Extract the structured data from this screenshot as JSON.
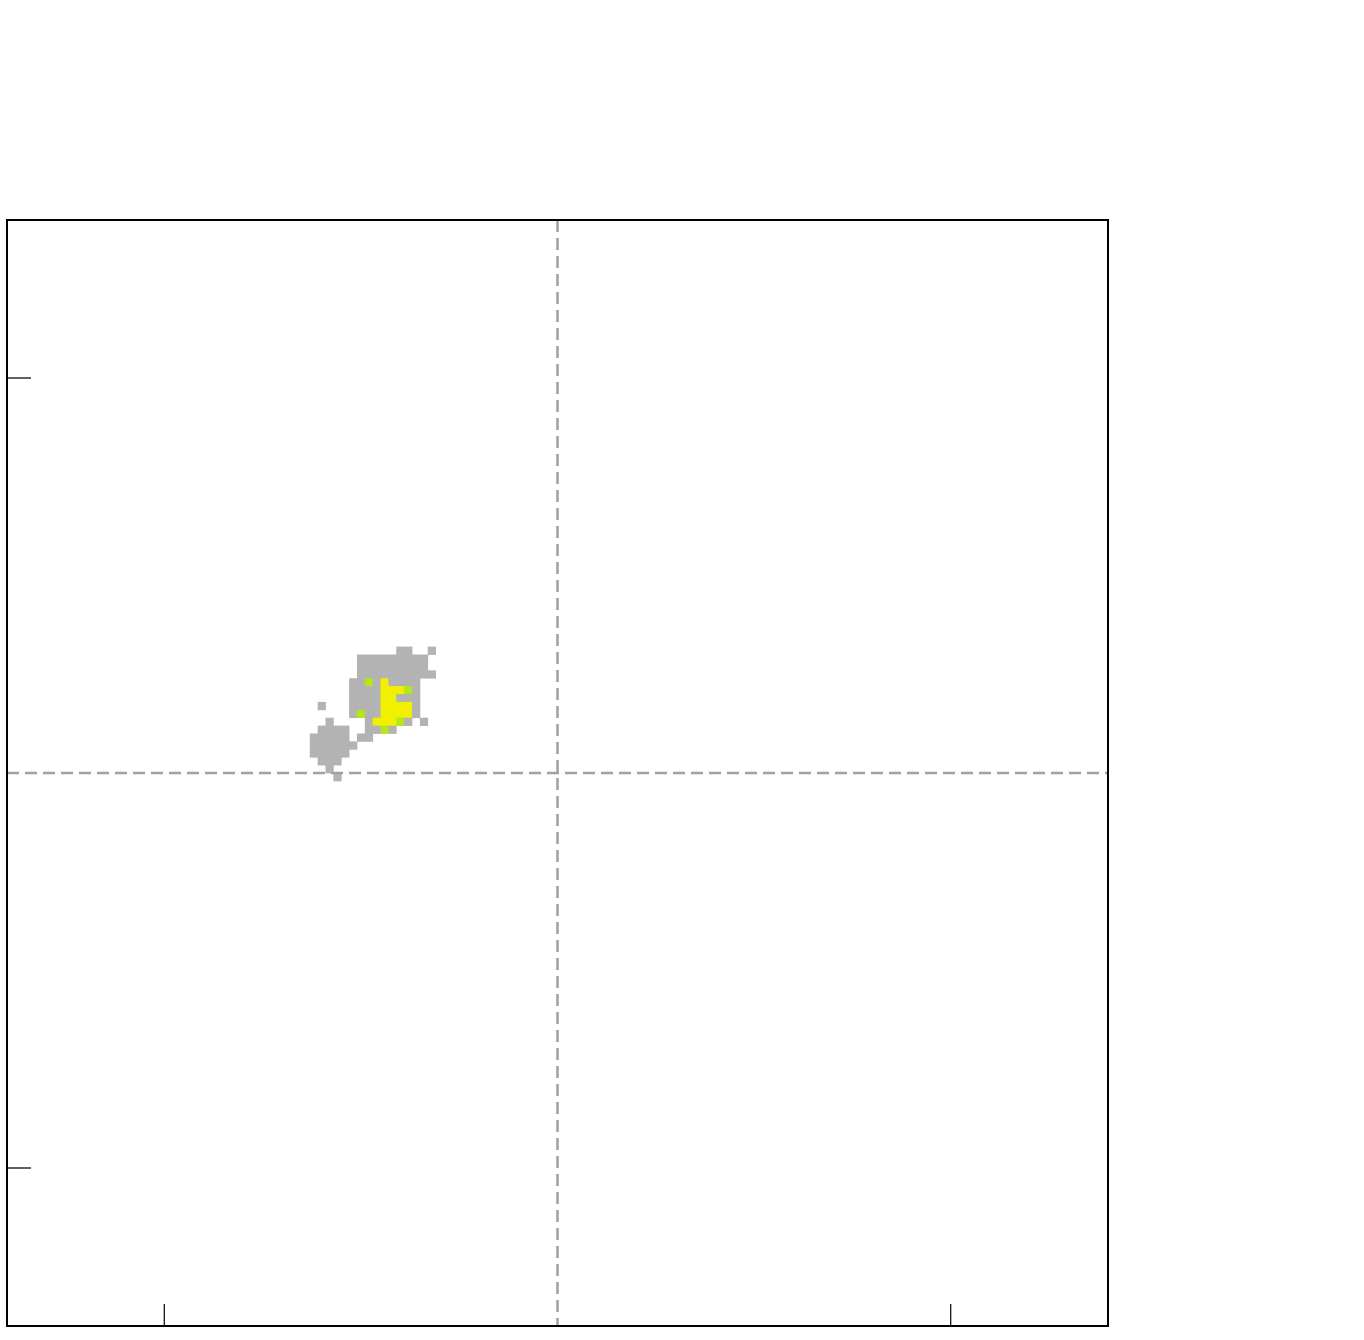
{
  "chart_data": {
    "type": "heatmap",
    "title": "",
    "xlabel": "",
    "ylabel": "",
    "xlim": [
      -1.4,
      1.4
    ],
    "ylim": [
      -1.4,
      1.4
    ],
    "x_ticks": [
      -1,
      1
    ],
    "y_ticks": [
      -1,
      1
    ],
    "x_tick_labels": [],
    "y_tick_labels": [],
    "reference_lines": {
      "x": 0,
      "y": 0,
      "style": "dashed"
    },
    "grid": false,
    "legend": "none",
    "cell_size": 0.02,
    "colors": {
      "frame": "#000000",
      "reference_line": "#a0a0a0",
      "low_density": "#b3b3b3",
      "mid_density": "#b5e61d",
      "high_density": "#f0f000"
    },
    "cells": [
      {
        "x": -0.4,
        "y": 0.31,
        "level": "low"
      },
      {
        "x": -0.38,
        "y": 0.31,
        "level": "low"
      },
      {
        "x": -0.32,
        "y": 0.31,
        "level": "low"
      },
      {
        "x": -0.5,
        "y": 0.29,
        "level": "low"
      },
      {
        "x": -0.48,
        "y": 0.29,
        "level": "low"
      },
      {
        "x": -0.46,
        "y": 0.29,
        "level": "low"
      },
      {
        "x": -0.44,
        "y": 0.29,
        "level": "low"
      },
      {
        "x": -0.42,
        "y": 0.29,
        "level": "low"
      },
      {
        "x": -0.4,
        "y": 0.29,
        "level": "low"
      },
      {
        "x": -0.38,
        "y": 0.29,
        "level": "low"
      },
      {
        "x": -0.36,
        "y": 0.29,
        "level": "low"
      },
      {
        "x": -0.34,
        "y": 0.29,
        "level": "low"
      },
      {
        "x": -0.5,
        "y": 0.27,
        "level": "low"
      },
      {
        "x": -0.48,
        "y": 0.27,
        "level": "low"
      },
      {
        "x": -0.46,
        "y": 0.27,
        "level": "low"
      },
      {
        "x": -0.44,
        "y": 0.27,
        "level": "low"
      },
      {
        "x": -0.42,
        "y": 0.27,
        "level": "low"
      },
      {
        "x": -0.4,
        "y": 0.27,
        "level": "low"
      },
      {
        "x": -0.38,
        "y": 0.27,
        "level": "low"
      },
      {
        "x": -0.36,
        "y": 0.27,
        "level": "low"
      },
      {
        "x": -0.34,
        "y": 0.27,
        "level": "low"
      },
      {
        "x": -0.5,
        "y": 0.25,
        "level": "low"
      },
      {
        "x": -0.48,
        "y": 0.25,
        "level": "low"
      },
      {
        "x": -0.46,
        "y": 0.25,
        "level": "low"
      },
      {
        "x": -0.44,
        "y": 0.25,
        "level": "low"
      },
      {
        "x": -0.42,
        "y": 0.25,
        "level": "low"
      },
      {
        "x": -0.4,
        "y": 0.25,
        "level": "low"
      },
      {
        "x": -0.38,
        "y": 0.25,
        "level": "low"
      },
      {
        "x": -0.36,
        "y": 0.25,
        "level": "low"
      },
      {
        "x": -0.34,
        "y": 0.25,
        "level": "low"
      },
      {
        "x": -0.32,
        "y": 0.25,
        "level": "low"
      },
      {
        "x": -0.52,
        "y": 0.23,
        "level": "low"
      },
      {
        "x": -0.5,
        "y": 0.23,
        "level": "low"
      },
      {
        "x": -0.48,
        "y": 0.23,
        "level": "mid"
      },
      {
        "x": -0.46,
        "y": 0.23,
        "level": "low"
      },
      {
        "x": -0.44,
        "y": 0.23,
        "level": "high"
      },
      {
        "x": -0.42,
        "y": 0.23,
        "level": "low"
      },
      {
        "x": -0.4,
        "y": 0.23,
        "level": "low"
      },
      {
        "x": -0.38,
        "y": 0.23,
        "level": "low"
      },
      {
        "x": -0.36,
        "y": 0.23,
        "level": "low"
      },
      {
        "x": -0.52,
        "y": 0.21,
        "level": "low"
      },
      {
        "x": -0.5,
        "y": 0.21,
        "level": "low"
      },
      {
        "x": -0.48,
        "y": 0.21,
        "level": "low"
      },
      {
        "x": -0.46,
        "y": 0.21,
        "level": "low"
      },
      {
        "x": -0.44,
        "y": 0.21,
        "level": "high"
      },
      {
        "x": -0.42,
        "y": 0.21,
        "level": "high"
      },
      {
        "x": -0.4,
        "y": 0.21,
        "level": "high"
      },
      {
        "x": -0.38,
        "y": 0.21,
        "level": "mid"
      },
      {
        "x": -0.36,
        "y": 0.21,
        "level": "low"
      },
      {
        "x": -0.52,
        "y": 0.19,
        "level": "low"
      },
      {
        "x": -0.5,
        "y": 0.19,
        "level": "low"
      },
      {
        "x": -0.48,
        "y": 0.19,
        "level": "low"
      },
      {
        "x": -0.46,
        "y": 0.19,
        "level": "low"
      },
      {
        "x": -0.44,
        "y": 0.19,
        "level": "high"
      },
      {
        "x": -0.42,
        "y": 0.19,
        "level": "high"
      },
      {
        "x": -0.4,
        "y": 0.19,
        "level": "low"
      },
      {
        "x": -0.38,
        "y": 0.19,
        "level": "low"
      },
      {
        "x": -0.36,
        "y": 0.19,
        "level": "low"
      },
      {
        "x": -0.6,
        "y": 0.17,
        "level": "low"
      },
      {
        "x": -0.52,
        "y": 0.17,
        "level": "low"
      },
      {
        "x": -0.5,
        "y": 0.17,
        "level": "low"
      },
      {
        "x": -0.48,
        "y": 0.17,
        "level": "low"
      },
      {
        "x": -0.46,
        "y": 0.17,
        "level": "low"
      },
      {
        "x": -0.44,
        "y": 0.17,
        "level": "high"
      },
      {
        "x": -0.42,
        "y": 0.17,
        "level": "high"
      },
      {
        "x": -0.4,
        "y": 0.17,
        "level": "high"
      },
      {
        "x": -0.38,
        "y": 0.17,
        "level": "high"
      },
      {
        "x": -0.36,
        "y": 0.17,
        "level": "low"
      },
      {
        "x": -0.52,
        "y": 0.15,
        "level": "low"
      },
      {
        "x": -0.5,
        "y": 0.15,
        "level": "mid"
      },
      {
        "x": -0.48,
        "y": 0.15,
        "level": "low"
      },
      {
        "x": -0.46,
        "y": 0.15,
        "level": "low"
      },
      {
        "x": -0.44,
        "y": 0.15,
        "level": "high"
      },
      {
        "x": -0.42,
        "y": 0.15,
        "level": "high"
      },
      {
        "x": -0.4,
        "y": 0.15,
        "level": "high"
      },
      {
        "x": -0.38,
        "y": 0.15,
        "level": "high"
      },
      {
        "x": -0.36,
        "y": 0.15,
        "level": "low"
      },
      {
        "x": -0.58,
        "y": 0.13,
        "level": "low"
      },
      {
        "x": -0.48,
        "y": 0.13,
        "level": "low"
      },
      {
        "x": -0.46,
        "y": 0.13,
        "level": "high"
      },
      {
        "x": -0.44,
        "y": 0.13,
        "level": "high"
      },
      {
        "x": -0.42,
        "y": 0.13,
        "level": "high"
      },
      {
        "x": -0.4,
        "y": 0.13,
        "level": "mid"
      },
      {
        "x": -0.38,
        "y": 0.13,
        "level": "low"
      },
      {
        "x": -0.34,
        "y": 0.13,
        "level": "low"
      },
      {
        "x": -0.6,
        "y": 0.11,
        "level": "low"
      },
      {
        "x": -0.58,
        "y": 0.11,
        "level": "low"
      },
      {
        "x": -0.56,
        "y": 0.11,
        "level": "low"
      },
      {
        "x": -0.54,
        "y": 0.11,
        "level": "low"
      },
      {
        "x": -0.48,
        "y": 0.11,
        "level": "low"
      },
      {
        "x": -0.46,
        "y": 0.11,
        "level": "low"
      },
      {
        "x": -0.44,
        "y": 0.11,
        "level": "mid"
      },
      {
        "x": -0.42,
        "y": 0.11,
        "level": "low"
      },
      {
        "x": -0.62,
        "y": 0.09,
        "level": "low"
      },
      {
        "x": -0.6,
        "y": 0.09,
        "level": "low"
      },
      {
        "x": -0.58,
        "y": 0.09,
        "level": "low"
      },
      {
        "x": -0.56,
        "y": 0.09,
        "level": "low"
      },
      {
        "x": -0.54,
        "y": 0.09,
        "level": "low"
      },
      {
        "x": -0.5,
        "y": 0.09,
        "level": "low"
      },
      {
        "x": -0.48,
        "y": 0.09,
        "level": "low"
      },
      {
        "x": -0.62,
        "y": 0.07,
        "level": "low"
      },
      {
        "x": -0.6,
        "y": 0.07,
        "level": "low"
      },
      {
        "x": -0.58,
        "y": 0.07,
        "level": "low"
      },
      {
        "x": -0.56,
        "y": 0.07,
        "level": "low"
      },
      {
        "x": -0.54,
        "y": 0.07,
        "level": "low"
      },
      {
        "x": -0.52,
        "y": 0.07,
        "level": "low"
      },
      {
        "x": -0.62,
        "y": 0.05,
        "level": "low"
      },
      {
        "x": -0.6,
        "y": 0.05,
        "level": "low"
      },
      {
        "x": -0.58,
        "y": 0.05,
        "level": "low"
      },
      {
        "x": -0.56,
        "y": 0.05,
        "level": "low"
      },
      {
        "x": -0.54,
        "y": 0.05,
        "level": "low"
      },
      {
        "x": -0.6,
        "y": 0.03,
        "level": "low"
      },
      {
        "x": -0.58,
        "y": 0.03,
        "level": "low"
      },
      {
        "x": -0.56,
        "y": 0.03,
        "level": "low"
      },
      {
        "x": -0.58,
        "y": 0.01,
        "level": "low"
      },
      {
        "x": -0.56,
        "y": -0.01,
        "level": "low"
      }
    ]
  }
}
